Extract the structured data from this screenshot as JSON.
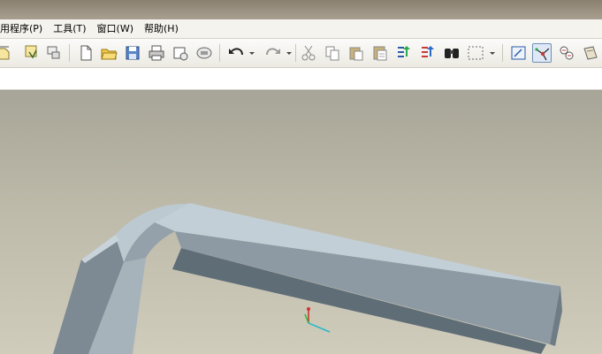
{
  "menu": {
    "items": [
      {
        "label": "用程序(P)"
      },
      {
        "label": "工具(T)"
      },
      {
        "label": "窗口(W)"
      },
      {
        "label": "帮助(H)"
      }
    ]
  },
  "toolbar": {
    "icons": [
      "new-icon",
      "open-icon",
      "save-icon",
      "print-icon",
      "email-icon",
      "mapkey-icon",
      "undo-icon",
      "redo-icon",
      "cut-icon",
      "copy-icon",
      "paste-icon",
      "paste-special-icon",
      "regenerate-icon",
      "regenerate-manager-icon",
      "find-icon",
      "select-box-icon",
      "repaint-icon",
      "spin-center-icon",
      "orient-icon",
      "view-manager-icon"
    ]
  },
  "colors": {
    "viewport_top": "#a7a597",
    "viewport_bottom": "#d0ccbc",
    "model_top": "#c3cfd7",
    "model_side": "#6c7b86",
    "model_front": "#8e9aa3",
    "accent_active": "#6b8fb8"
  }
}
